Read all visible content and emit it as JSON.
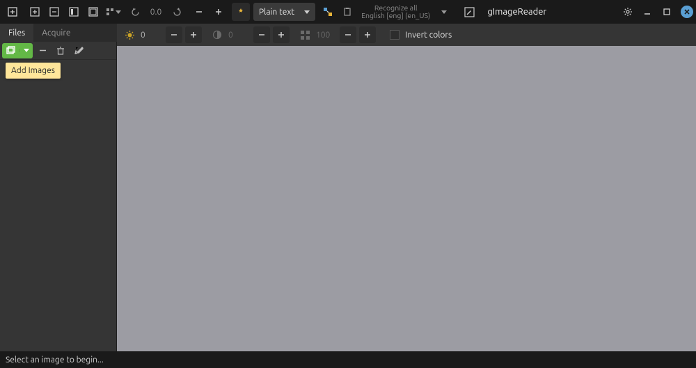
{
  "app_title": "gImageReader",
  "titlebar": {
    "rotate_value": "0.0",
    "mode_label": "Plain text",
    "recognize_line1": "Recognize all",
    "recognize_line2": "English [eng] (en_US)"
  },
  "tabs": {
    "files": "Files",
    "acquire": "Acquire"
  },
  "view_toolbar": {
    "brightness_value": "0",
    "contrast_value": "0",
    "resolution_value": "100",
    "invert_label": "Invert colors"
  },
  "sidebar": {
    "tooltip": "Add Images"
  },
  "status": "Select an image to begin...",
  "icons": {
    "brightness": "brightness-icon",
    "contrast": "contrast-icon",
    "resolution": "resolution-icon"
  }
}
